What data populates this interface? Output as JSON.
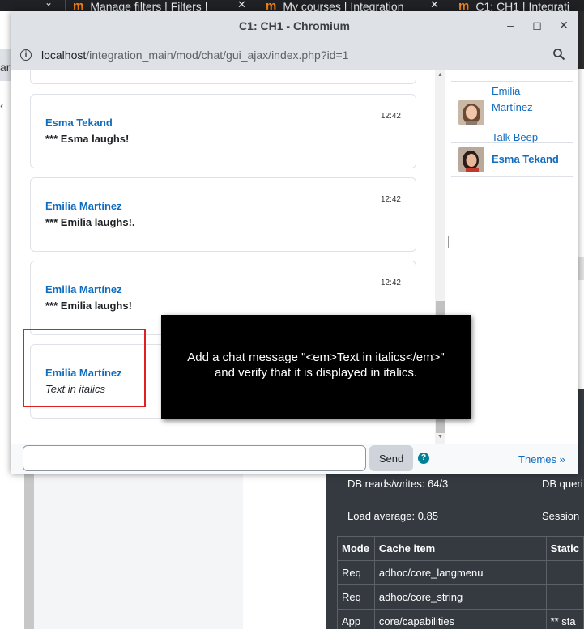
{
  "background_browser": {
    "tabs": [
      {
        "label": "Manage filters | Filters |"
      },
      {
        "label": "My courses | Integration"
      },
      {
        "label": "C1: CH1 | Integrati"
      }
    ],
    "left_fragment": "ar",
    "footer": {
      "db_reads": "DB reads/writes: 64/3",
      "db_queries_fragment": "DB queri",
      "load_average": "Load average: 0.85",
      "session_fragment": "Session",
      "cache_table": {
        "headers": [
          "Mode",
          "Cache item",
          "Static"
        ],
        "rows": [
          [
            "Req",
            "adhoc/core_langmenu",
            ""
          ],
          [
            "Req",
            "adhoc/core_string",
            ""
          ],
          [
            "App",
            "core/capabilities",
            "** sta"
          ]
        ]
      }
    }
  },
  "window": {
    "title": "C1: CH1 - Chromium",
    "url_host": "localhost",
    "url_path": "/integration_main/mod/chat/gui_ajax/index.php?id=1"
  },
  "messages": [
    {
      "author": "Esma Tekand",
      "time": "12:42",
      "text": "*** Esma laughs!",
      "italic": false
    },
    {
      "author": "Emilia Martínez",
      "time": "12:42",
      "text": "*** Emilia laughs!.",
      "italic": false
    },
    {
      "author": "Emilia Martínez",
      "time": "12:42",
      "text": "*** Emilia laughs!",
      "italic": false
    },
    {
      "author": "Emilia Martínez",
      "time": "",
      "text": "Text in italics",
      "italic": true
    }
  ],
  "users": [
    {
      "name_lines": [
        "Emilia",
        "Martínez"
      ],
      "beep": "Talk Beep"
    },
    {
      "name": "Esma Tekand"
    }
  ],
  "input": {
    "value": "",
    "placeholder": ""
  },
  "send_label": "Send",
  "help_label": "?",
  "themes_label": "Themes »",
  "tooltip": {
    "line1": "Add a chat message \"<em>Text in italics</em>\"",
    "line2": "and verify that it is displayed in italics."
  },
  "colors": {
    "link": "#0f6cbf",
    "highlight": "#e02020",
    "footer_bg": "#343a40",
    "brand": "#f98012"
  },
  "icons": [
    "moodle-logo-icon",
    "close-icon",
    "minimize-icon",
    "maximize-icon",
    "info-icon",
    "zoom-icon",
    "help-icon"
  ]
}
